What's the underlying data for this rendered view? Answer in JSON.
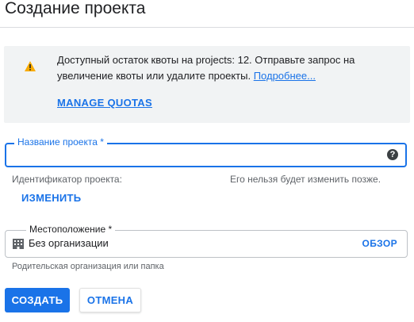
{
  "page": {
    "title": "Создание проекта"
  },
  "notice": {
    "icon": "warning-icon",
    "text": "Доступный остаток квоты на projects: 12. Отправьте запрос на увеличение квоты или удалите проекты.",
    "link": "Подробнее...",
    "action": "MANAGE QUOTAS"
  },
  "project_name": {
    "label": "Название проекта *",
    "value": "",
    "help_icon": "help-icon",
    "help_glyph": "?"
  },
  "project_id": {
    "label": "Идентификатор проекта:",
    "note": "Его нельзя будет изменить позже.",
    "change_label": "ИЗМЕНИТЬ"
  },
  "location": {
    "label": "Местоположение *",
    "icon": "organization-icon",
    "value": "Без организации",
    "browse_label": "ОБЗОР",
    "hint": "Родительская организация или папка"
  },
  "actions": {
    "create": "СОЗДАТЬ",
    "cancel": "ОТМЕНА"
  },
  "colors": {
    "accent": "#1a73e8",
    "warning": "#f9ab00",
    "notice_background": "#f1f3f4",
    "text": "#202124",
    "secondary_text": "#5f6368"
  }
}
